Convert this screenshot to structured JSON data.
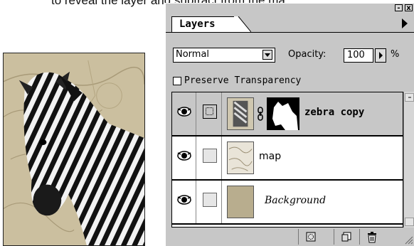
{
  "caption": "to reveal the layer and subtract from the ma",
  "palette": {
    "tab_label": "Layers",
    "blend_mode": "Normal",
    "opacity_label": "Opacity:",
    "opacity_value": "100",
    "opacity_unit": "%",
    "preserve_transparency_label": "Preserve Transparency",
    "preserve_transparency_checked": false,
    "minimize_label": "-",
    "close_label": "x",
    "layers": [
      {
        "name": "zebra copy",
        "visible": true,
        "active": true,
        "has_mask": true
      },
      {
        "name": "map",
        "visible": true,
        "active": false,
        "has_mask": false
      },
      {
        "name": "Background",
        "visible": true,
        "active": false,
        "has_mask": false
      }
    ],
    "bottom_buttons": [
      "add-mask-icon",
      "new-layer-icon",
      "trash-icon"
    ]
  },
  "colors": {
    "panel_gray": "#c7c7c7",
    "map_tan": "#bfb496",
    "background_swatch": "#b8ad8e"
  }
}
